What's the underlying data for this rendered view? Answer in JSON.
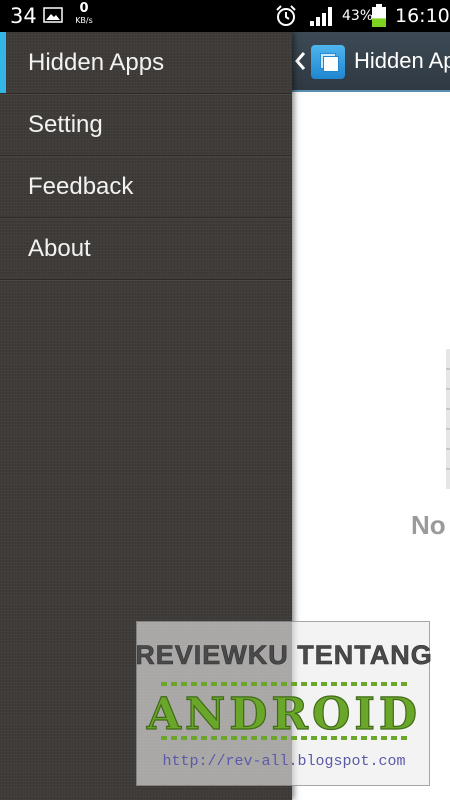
{
  "status_bar": {
    "notification_count": "34",
    "speed_value": "0",
    "speed_unit": "KB/s",
    "battery_percent": "43%",
    "time": "16:10",
    "icons": [
      "image-icon",
      "alarm-icon",
      "signal-icon",
      "battery-icon"
    ],
    "battery_level": 0.43
  },
  "app": {
    "title": "Hidden Apps",
    "empty_text": "No"
  },
  "drawer": {
    "items": [
      {
        "label": "Hidden Apps",
        "selected": true
      },
      {
        "label": "Setting",
        "selected": false
      },
      {
        "label": "Feedback",
        "selected": false
      },
      {
        "label": "About",
        "selected": false
      }
    ]
  },
  "watermark": {
    "line1": "REVIEWKU TENTANG",
    "line2": "ANDROID",
    "url": "http://rev-all.blogspot.com"
  },
  "colors": {
    "drawer_bg": "#3f3b38",
    "selection_accent": "#33b5e5",
    "battery_fill": "#7ed321",
    "watermark_green": "#6aa629"
  }
}
